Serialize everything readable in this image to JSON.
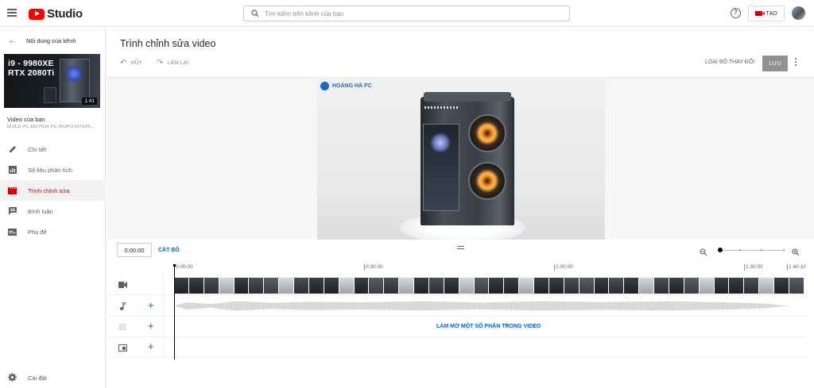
{
  "header": {
    "logo_text": "Studio",
    "search_placeholder": "Tìm kiếm trên kênh của bạn",
    "create_label": "TẠO"
  },
  "sidebar": {
    "back_label": "Nội dung của kênh",
    "thumbnail": {
      "title_lines": [
        "i9 - 9980XE",
        "RTX 2080Ti"
      ],
      "duration": "1:41"
    },
    "your_video_label": "Video của bạn",
    "video_title": "BUILD PC ĐỒ HOẠ PC WORSTATION...",
    "items": [
      {
        "label": "Chi tiết",
        "icon": "pencil-icon"
      },
      {
        "label": "Số liệu phân tích",
        "icon": "analytics-icon"
      },
      {
        "label": "Trình chỉnh sửa",
        "icon": "clapperboard-icon",
        "active": true
      },
      {
        "label": "Bình luận",
        "icon": "comment-icon"
      },
      {
        "label": "Phụ đề",
        "icon": "subtitles-icon"
      }
    ],
    "settings_label": "Cài đặt"
  },
  "editor": {
    "title": "Trình chỉnh sửa video",
    "undo_label": "HỦY",
    "redo_label": "LÀM LẠI",
    "discard_label": "LOẠI BỎ THAY ĐỔI",
    "save_label": "LƯU",
    "preview_watermark": "HOÀNG HÀ PC"
  },
  "timeline": {
    "current_time": "0:00:00",
    "trim_label": "CẮT BỎ",
    "ruler": [
      {
        "label": "0:00:00",
        "pos": 0
      },
      {
        "label": "0:30:00",
        "pos": 0.301
      },
      {
        "label": "1:00:00",
        "pos": 0.601
      },
      {
        "label": "1:30:00",
        "pos": 0.902
      },
      {
        "label": "1:40:10",
        "pos": 0.97
      }
    ],
    "blur_label": "LÀM MỜ MỘT SỐ PHẦN TRONG VIDEO",
    "tracks": [
      {
        "icon": "video-track-icon"
      },
      {
        "icon": "music-note-icon"
      },
      {
        "icon": "blur-icon"
      },
      {
        "icon": "end-screen-icon"
      }
    ]
  },
  "colors": {
    "accent": "#065fd4",
    "brand_red": "#ff0000",
    "active_red": "#cc0000"
  }
}
